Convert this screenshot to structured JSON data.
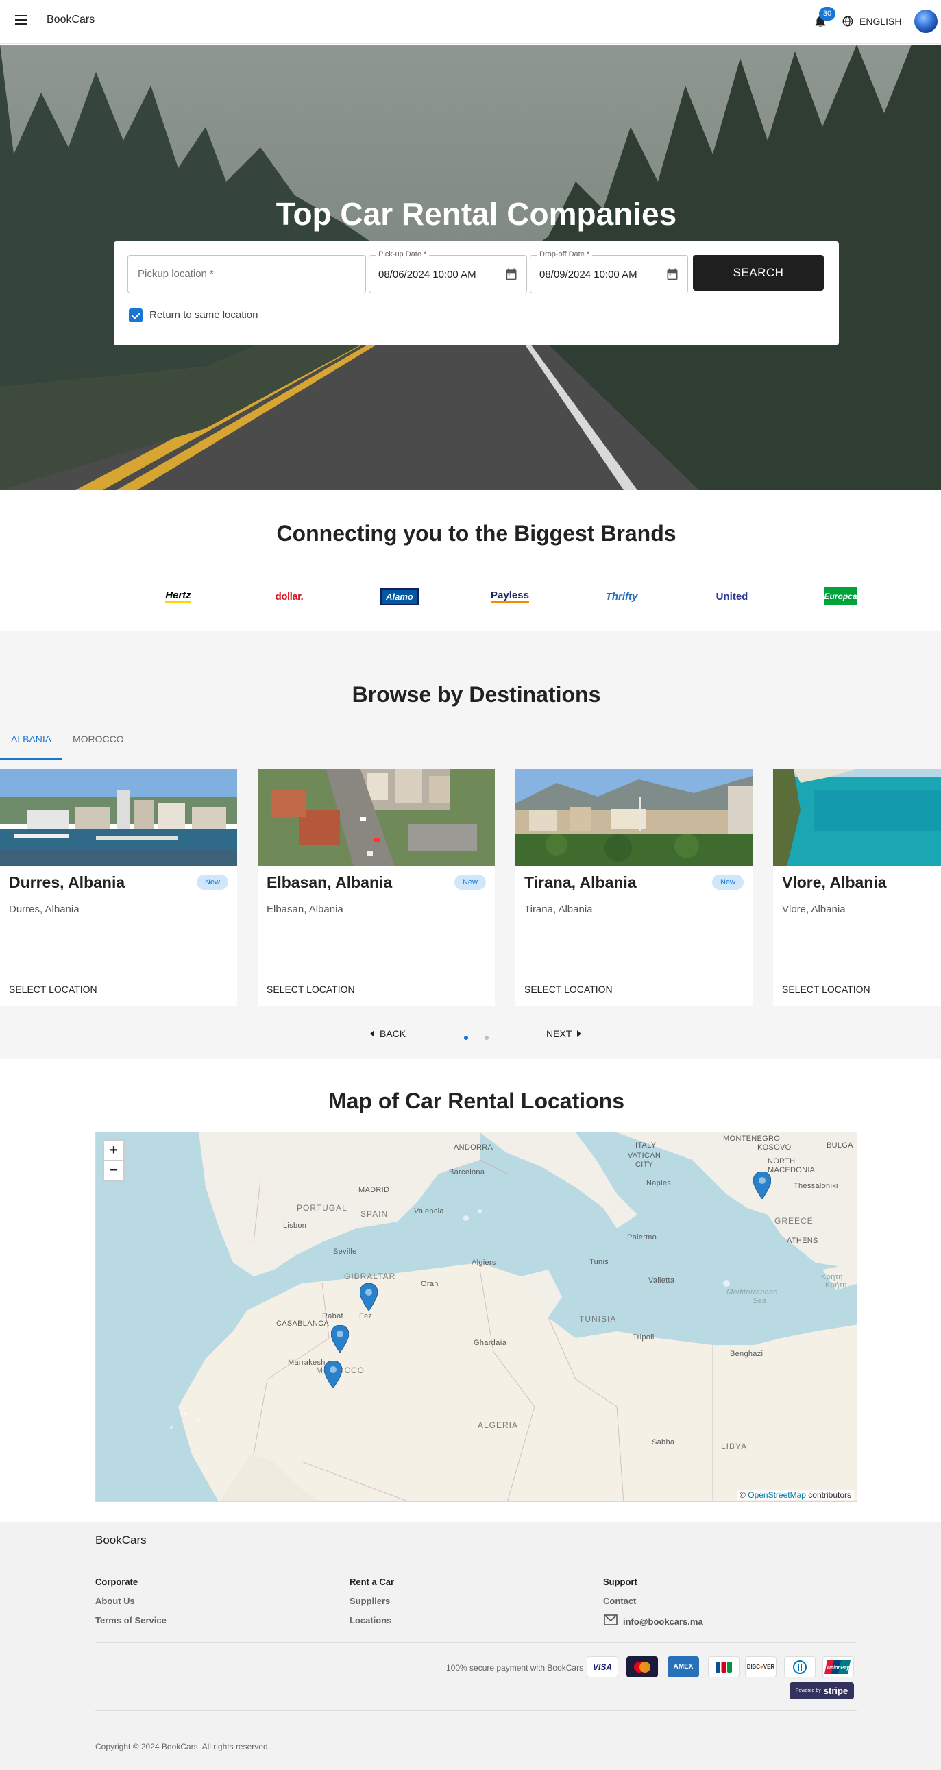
{
  "header": {
    "brand": "BookCars",
    "notification_count": "30",
    "language": "ENGLISH"
  },
  "hero": {
    "title": "Top Car Rental Companies",
    "pickup_placeholder": "Pickup location *",
    "pickup_date_label": "Pick-up Date *",
    "pickup_date_value": "08/06/2024 10:00 AM",
    "dropoff_date_label": "Drop-off Date *",
    "dropoff_date_value": "08/09/2024 10:00 AM",
    "search_label": "SEARCH",
    "return_same_label": "Return to same location",
    "return_same_checked": true
  },
  "brands": {
    "title": "Connecting you to the Biggest Brands",
    "items": [
      {
        "name": "Hertz",
        "color": "#000000",
        "accent": "#ffd200"
      },
      {
        "name": "dollar.",
        "color": "#d71920",
        "accent": "#ffffff"
      },
      {
        "name": "Alamo",
        "color": "#ffffff",
        "accent": "#0058a3"
      },
      {
        "name": "Payless",
        "color": "#1a2a5e",
        "accent": "#f28c00"
      },
      {
        "name": "Thrifty",
        "color": "#2a6ebb",
        "accent": "#ffffff"
      },
      {
        "name": "United",
        "color": "#2b3a96",
        "accent": "#ffffff"
      },
      {
        "name": "Europca",
        "color": "#ffffff",
        "accent": "#00a33a"
      }
    ]
  },
  "destinations": {
    "title": "Browse by Destinations",
    "tabs": [
      {
        "label": "ALBANIA",
        "active": true
      },
      {
        "label": "MOROCCO",
        "active": false
      }
    ],
    "cards": [
      {
        "title": "Durres, Albania",
        "subtitle": "Durres, Albania",
        "badge": "New",
        "action": "SELECT LOCATION"
      },
      {
        "title": "Elbasan, Albania",
        "subtitle": "Elbasan, Albania",
        "badge": "New",
        "action": "SELECT LOCATION"
      },
      {
        "title": "Tirana, Albania",
        "subtitle": "Tirana, Albania",
        "badge": "New",
        "action": "SELECT LOCATION"
      },
      {
        "title": "Vlore, Albania",
        "subtitle": "Vlore, Albania",
        "badge": "",
        "action": "SELECT LOCATION"
      }
    ],
    "back_label": "BACK",
    "next_label": "NEXT",
    "page": 1,
    "pages": 2
  },
  "map": {
    "title": "Map of Car Rental Locations",
    "zoom_in": "+",
    "zoom_out": "−",
    "attribution_prefix": "©",
    "attribution_link": "OpenStreetMap",
    "attribution_suffix": "contributors",
    "labels": {
      "montenegro": "MONTENEGRO",
      "kosovo": "KOSOVO",
      "bulgaria": "BULGA",
      "italy": "ITALY",
      "vatican": "VATICAN CITY",
      "andorra": "ANDORRA",
      "north_macedonia": "NORTH MACEDONIA",
      "barcelona": "Barcelona",
      "naples": "Naples",
      "thessaloniki": "Thessaloniki",
      "portugal": "PORTUGAL",
      "madrid": "MADRID",
      "spain": "SPAIN",
      "valencia": "Valencia",
      "lisbon": "Lisbon",
      "greece": "GREECE",
      "athens": "ATHENS",
      "palermo": "Palermo",
      "seville": "Seville",
      "algiers": "Algiers",
      "tunis": "Tunis",
      "gibraltar": "GIBRALTAR",
      "oran": "Oran",
      "valletta": "Valletta",
      "kriti": "Κρήτη",
      "kriti2": "Κρήτη",
      "mediterranean": "Mediterranean",
      "sea": "Sea",
      "rabat": "Rabat",
      "fez": "Fez",
      "tunisia": "TUNISIA",
      "casablanca": "CASABLANCA",
      "tripoli": "Tripoli",
      "ghardaia": "Ghardaïa",
      "benghazi": "Benghazi",
      "marrakesh": "Marrakesh",
      "morocco": "MOROCCO",
      "algeria": "ALGERIA",
      "sabha": "Sabha",
      "libya": "LIBYA"
    }
  },
  "footer": {
    "brand": "BookCars",
    "columns": [
      {
        "heading": "Corporate",
        "links": [
          "About Us",
          "Terms of Service"
        ]
      },
      {
        "heading": "Rent a Car",
        "links": [
          "Suppliers",
          "Locations"
        ]
      },
      {
        "heading": "Support",
        "links": [
          "Contact",
          "info@bookcars.ma"
        ]
      }
    ],
    "secure_payment": "100% secure payment with BookCars",
    "payment_methods": [
      "VISA",
      "MASTERCARD",
      "AMEX",
      "JCB",
      "DISCOVER",
      "DINERS",
      "UnionPay"
    ],
    "stripe_prefix": "Powered by",
    "stripe_name": "stripe",
    "copyright": "Copyright © 2024 BookCars. All rights reserved."
  }
}
